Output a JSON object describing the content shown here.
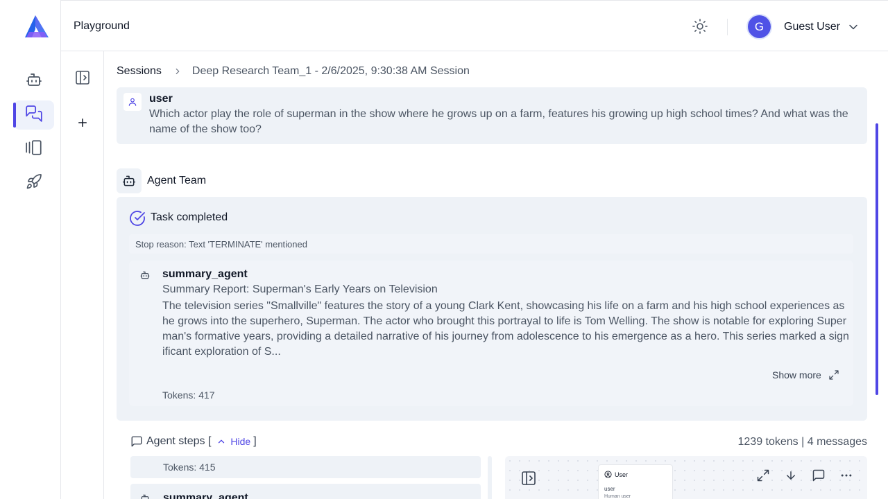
{
  "app": {
    "title": "Playground"
  },
  "header": {
    "user_initial": "G",
    "user_name": "Guest User"
  },
  "nav": {
    "items": [
      {
        "name": "team-builder",
        "icon": "robot-icon",
        "active": false
      },
      {
        "name": "playground",
        "icon": "chat-icon",
        "active": true
      },
      {
        "name": "gallery",
        "icon": "gallery-icon",
        "active": false
      },
      {
        "name": "deploy",
        "icon": "rocket-icon",
        "active": false
      }
    ]
  },
  "breadcrumb": {
    "root": "Sessions",
    "current": "Deep Research Team_1 - 2/6/2025, 9:30:38 AM Session"
  },
  "user_message": {
    "sender": "user",
    "text": "Which actor play the role of superman in the show where he grows up on a farm, features his growing up high school times? And what was the name of the show too?"
  },
  "agent_team": {
    "label": "Agent Team",
    "status": "Task completed",
    "stop_reason": "Stop reason: Text 'TERMINATE' mentioned",
    "summary": {
      "agent": "summary_agent",
      "title": "Summary Report: Superman's Early Years on Television",
      "body": "The television series \"Smallville\" features the story of a young Clark Kent, showcasing his life on a farm and his high school experiences as he grows into the superhero, Superman. The actor who brought this portrayal to life is Tom Welling. The show is notable for exploring Superman's formative years, providing a detailed narrative of his journey from adolescence to his emergence as a hero. This series marked a significant exploration of S...",
      "show_more": "Show more",
      "tokens": "Tokens: 417"
    }
  },
  "agent_steps": {
    "label": "Agent steps [",
    "hide": "Hide",
    "close_bracket": "]",
    "stats": "1239 tokens | 4 messages",
    "step1_tokens": "Tokens: 415",
    "step2_agent": "summary_agent"
  },
  "graph": {
    "node_title": "User",
    "node_role": "user",
    "node_desc": "Human user"
  },
  "colors": {
    "accent": "#4f46e5",
    "panel": "#eef2f7"
  }
}
